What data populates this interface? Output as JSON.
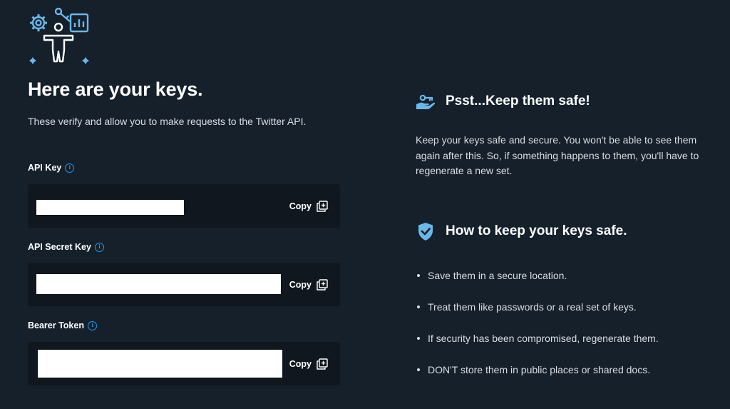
{
  "header": {
    "title": "Here are your keys.",
    "subtitle": "These verify and allow you to make requests to the Twitter API."
  },
  "keys": [
    {
      "label": "API Key",
      "value": "",
      "copy_label": "Copy"
    },
    {
      "label": "API Secret Key",
      "value": "",
      "copy_label": "Copy"
    },
    {
      "label": "Bearer Token",
      "value": "",
      "copy_label": "Copy"
    }
  ],
  "safety": {
    "title": "Psst...Keep them safe!",
    "text": "Keep your keys safe and secure. You won't be able to see them again after this. So, if something happens to them, you'll have to regenerate a new set."
  },
  "how_to": {
    "title": "How to keep your keys safe.",
    "tips": [
      "Save them in a secure location.",
      "Treat them like passwords or a real set of keys.",
      "If security has been compromised, regenerate them.",
      "DON'T store them in public places or shared docs."
    ]
  },
  "icons": {
    "hero": "person-with-gear-key-chart-illustration",
    "info": "info-icon",
    "copy": "copy-icon",
    "safety": "hand-holding-key-icon",
    "shield": "shield-check-icon"
  },
  "colors": {
    "background": "#15202b",
    "field_background": "#10171e",
    "accent": "#1d9bf0",
    "icon_blue": "#6ab8e8",
    "text_secondary": "#d9dde1"
  }
}
